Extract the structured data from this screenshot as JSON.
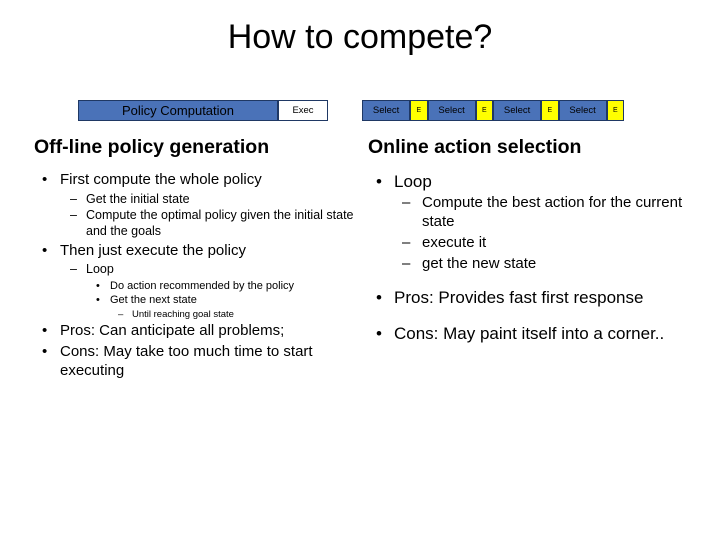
{
  "slide": {
    "title": "How to compete?",
    "diagram": {
      "left_bar": {
        "main_label": "Policy Computation",
        "exec_label": "Exec"
      },
      "right_bar": {
        "segments": [
          {
            "label": "Select",
            "marker": "E"
          },
          {
            "label": "Select",
            "marker": "E"
          },
          {
            "label": "Select",
            "marker": "E"
          },
          {
            "label": "Select",
            "marker": "E"
          }
        ]
      }
    },
    "left_column": {
      "heading": "Off-line policy generation",
      "items": [
        {
          "text": "First compute the whole policy",
          "children": [
            {
              "text": "Get the initial state"
            },
            {
              "text": "Compute the optimal policy given the initial state and the goals"
            }
          ]
        },
        {
          "text": "Then just execute the policy",
          "children": [
            {
              "text": "Loop",
              "children": [
                {
                  "text": "Do action recommended by the policy"
                },
                {
                  "text": "Get the next state",
                  "children": [
                    {
                      "text": "Until reaching goal state"
                    }
                  ]
                }
              ]
            }
          ]
        },
        {
          "text": "Pros: Can anticipate all problems;"
        },
        {
          "text": "Cons: May take too much time to start executing"
        }
      ]
    },
    "right_column": {
      "heading": "Online action selection",
      "items": [
        {
          "text": "Loop",
          "children": [
            {
              "text": "Compute the best action for the current state"
            },
            {
              "text": " execute it"
            },
            {
              "text": "get the new state"
            }
          ]
        },
        {
          "text": "Pros: Provides fast first response"
        },
        {
          "text": "Cons: May paint itself into a corner.."
        }
      ]
    },
    "bullets": {
      "level1": "•",
      "level2": "–",
      "level3": "•",
      "level4": "–"
    }
  }
}
